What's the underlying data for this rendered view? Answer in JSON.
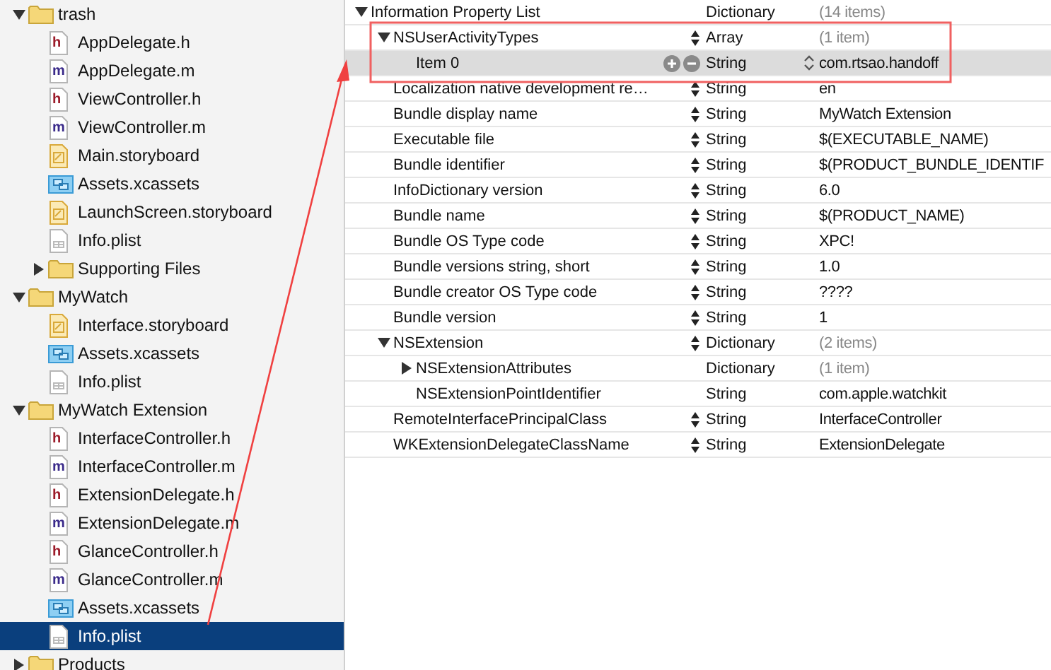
{
  "navigator": {
    "items": [
      {
        "label": "trash",
        "kind": "folder",
        "expanded": true,
        "selected": false,
        "children": [
          {
            "label": "AppDelegate.h",
            "kind": "header",
            "badge": "h",
            "selected": false
          },
          {
            "label": "AppDelegate.m",
            "kind": "source",
            "badge": "m",
            "selected": false
          },
          {
            "label": "ViewController.h",
            "kind": "header",
            "badge": "h",
            "selected": false
          },
          {
            "label": "ViewController.m",
            "kind": "source",
            "badge": "m",
            "selected": false
          },
          {
            "label": "Main.storyboard",
            "kind": "storyboard",
            "selected": false
          },
          {
            "label": "Assets.xcassets",
            "kind": "assets",
            "selected": false
          },
          {
            "label": "LaunchScreen.storyboard",
            "kind": "storyboard",
            "selected": false
          },
          {
            "label": "Info.plist",
            "kind": "plist",
            "selected": false
          },
          {
            "label": "Supporting Files",
            "kind": "folder",
            "expanded": false,
            "selected": false
          }
        ]
      },
      {
        "label": "MyWatch",
        "kind": "folder",
        "expanded": true,
        "selected": false,
        "children": [
          {
            "label": "Interface.storyboard",
            "kind": "storyboard",
            "selected": false
          },
          {
            "label": "Assets.xcassets",
            "kind": "assets",
            "selected": false
          },
          {
            "label": "Info.plist",
            "kind": "plist",
            "selected": false
          }
        ]
      },
      {
        "label": "MyWatch Extension",
        "kind": "folder",
        "expanded": true,
        "selected": false,
        "children": [
          {
            "label": "InterfaceController.h",
            "kind": "header",
            "badge": "h",
            "selected": false
          },
          {
            "label": "InterfaceController.m",
            "kind": "source",
            "badge": "m",
            "selected": false
          },
          {
            "label": "ExtensionDelegate.h",
            "kind": "header",
            "badge": "h",
            "selected": false
          },
          {
            "label": "ExtensionDelegate.m",
            "kind": "source",
            "badge": "m",
            "selected": false
          },
          {
            "label": "GlanceController.h",
            "kind": "header",
            "badge": "h",
            "selected": false
          },
          {
            "label": "GlanceController.m",
            "kind": "source",
            "badge": "m",
            "selected": false
          },
          {
            "label": "Assets.xcassets",
            "kind": "assets",
            "selected": false
          },
          {
            "label": "Info.plist",
            "kind": "plist",
            "selected": true
          }
        ]
      },
      {
        "label": "Products",
        "kind": "folder",
        "expanded": false,
        "selected": false
      }
    ]
  },
  "plist": {
    "rows": [
      {
        "key": "Information Property List",
        "type": "Dictionary",
        "value": "(14 items)",
        "dimmed": true,
        "expanded": true,
        "stepper": false,
        "selected": false,
        "children": [
          {
            "key": "NSUserActivityTypes",
            "type": "Array",
            "value": "(1 item)",
            "dimmed": true,
            "expanded": true,
            "stepper": true,
            "selected": false,
            "children": [
              {
                "key": "Item 0",
                "type": "String",
                "value": "com.rtsao.handoff",
                "dimmed": false,
                "stepper": false,
                "selected": true
              }
            ]
          },
          {
            "key": "Localization native development re…",
            "type": "String",
            "value": "en",
            "dimmed": false,
            "stepper": true,
            "selected": false
          },
          {
            "key": "Bundle display name",
            "type": "String",
            "value": "MyWatch Extension",
            "dimmed": false,
            "stepper": true,
            "selected": false
          },
          {
            "key": "Executable file",
            "type": "String",
            "value": "$(EXECUTABLE_NAME)",
            "dimmed": false,
            "stepper": true,
            "selected": false
          },
          {
            "key": "Bundle identifier",
            "type": "String",
            "value": "$(PRODUCT_BUNDLE_IDENTIF",
            "dimmed": false,
            "stepper": true,
            "selected": false
          },
          {
            "key": "InfoDictionary version",
            "type": "String",
            "value": "6.0",
            "dimmed": false,
            "stepper": true,
            "selected": false
          },
          {
            "key": "Bundle name",
            "type": "String",
            "value": "$(PRODUCT_NAME)",
            "dimmed": false,
            "stepper": true,
            "selected": false
          },
          {
            "key": "Bundle OS Type code",
            "type": "String",
            "value": "XPC!",
            "dimmed": false,
            "stepper": true,
            "selected": false
          },
          {
            "key": "Bundle versions string, short",
            "type": "String",
            "value": "1.0",
            "dimmed": false,
            "stepper": true,
            "selected": false
          },
          {
            "key": "Bundle creator OS Type code",
            "type": "String",
            "value": "????",
            "dimmed": false,
            "stepper": true,
            "selected": false
          },
          {
            "key": "Bundle version",
            "type": "String",
            "value": "1",
            "dimmed": false,
            "stepper": true,
            "selected": false
          },
          {
            "key": "NSExtension",
            "type": "Dictionary",
            "value": "(2 items)",
            "dimmed": true,
            "expanded": true,
            "stepper": true,
            "selected": false,
            "children": [
              {
                "key": "NSExtensionAttributes",
                "type": "Dictionary",
                "value": "(1 item)",
                "dimmed": true,
                "expanded": false,
                "stepper": false,
                "selected": false
              },
              {
                "key": "NSExtensionPointIdentifier",
                "type": "String",
                "value": "com.apple.watchkit",
                "dimmed": false,
                "stepper": false,
                "selected": false
              }
            ]
          },
          {
            "key": "RemoteInterfacePrincipalClass",
            "type": "String",
            "value": "InterfaceController",
            "dimmed": false,
            "stepper": true,
            "selected": false
          },
          {
            "key": "WKExtensionDelegateClassName",
            "type": "String",
            "value": "ExtensionDelegate",
            "dimmed": false,
            "stepper": true,
            "selected": false
          }
        ]
      }
    ]
  },
  "annotations": {
    "highlight_box": true,
    "arrow": true
  }
}
